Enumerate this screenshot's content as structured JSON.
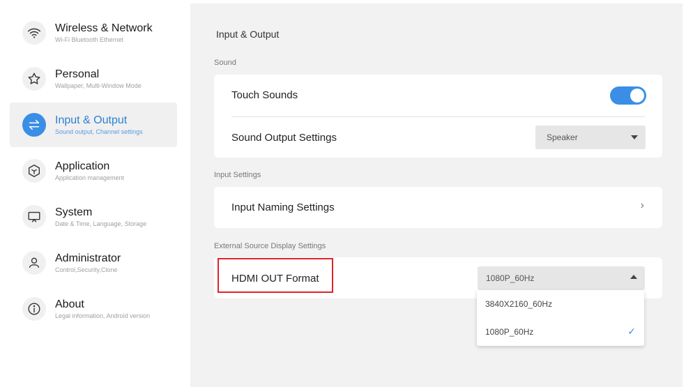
{
  "sidebar": {
    "items": [
      {
        "title": "Wireless & Network",
        "subtitle": "Wi-Fi Bluetooth Ethernet",
        "icon": "wifi-icon"
      },
      {
        "title": "Personal",
        "subtitle": "Wallpaper, Multi-Window Mode",
        "icon": "star-icon"
      },
      {
        "title": "Input & Output",
        "subtitle": "Sound output, Channel settings",
        "icon": "swap-arrows-icon",
        "active": true
      },
      {
        "title": "Application",
        "subtitle": "Application management",
        "icon": "cube-icon"
      },
      {
        "title": "System",
        "subtitle": "Date & Time, Language, Storage",
        "icon": "monitor-icon"
      },
      {
        "title": "Administrator",
        "subtitle": "Control,Security,Clone",
        "icon": "user-icon"
      },
      {
        "title": "About",
        "subtitle": "Legal information, Android version",
        "icon": "info-icon"
      }
    ]
  },
  "main": {
    "title": "Input & Output",
    "sections": {
      "sound": {
        "label": "Sound",
        "touch_sounds": {
          "label": "Touch Sounds",
          "enabled": true
        },
        "sound_output": {
          "label": "Sound Output Settings",
          "value": "Speaker"
        }
      },
      "input": {
        "label": "Input Settings",
        "naming": {
          "label": "Input Naming Settings",
          "icon": "chevron-right-icon"
        }
      },
      "external": {
        "label": "External Source Display Settings",
        "hdmi_out": {
          "label": "HDMI OUT Format",
          "value": "1080P_60Hz"
        }
      }
    },
    "dropdown": {
      "options": [
        {
          "label": "3840X2160_60Hz",
          "selected": false
        },
        {
          "label": "1080P_60Hz",
          "selected": true
        }
      ],
      "check_glyph": "✓"
    },
    "chevron_glyph": "›"
  },
  "colors": {
    "accent": "#3a8ee6",
    "highlight": "#e0222a",
    "panel": "#f2f2f2"
  }
}
